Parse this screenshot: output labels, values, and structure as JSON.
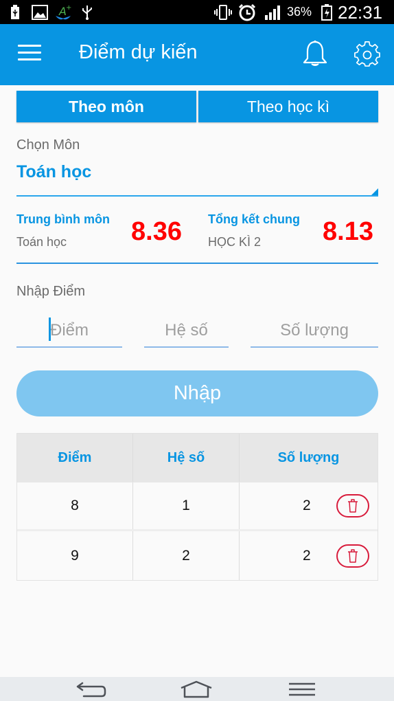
{
  "status_bar": {
    "left_icons": [
      "usb-battery-icon",
      "gallery-icon",
      "app-aplus-icon",
      "usb-icon"
    ],
    "right_icons": [
      "vibrate-icon",
      "alarm-icon",
      "signal-icon",
      "charging-battery-icon"
    ],
    "battery_percent": "36%",
    "time": "22:31"
  },
  "app_bar": {
    "title": "Điểm dự kiến",
    "menu_icon": "hamburger-menu-icon",
    "notification_icon": "bell-icon",
    "settings_icon": "gear-icon"
  },
  "tabs": [
    {
      "label": "Theo môn",
      "active": true
    },
    {
      "label": "Theo học kì",
      "active": false
    }
  ],
  "subject": {
    "label": "Chọn Môn",
    "selected": "Toán học"
  },
  "stats": {
    "subject_avg": {
      "label": "Trung bình môn",
      "sub": "Toán học",
      "value": "8.36"
    },
    "overall": {
      "label": "Tổng kết chung",
      "sub": "HỌC KÌ 2",
      "value": "8.13"
    }
  },
  "entry": {
    "label": "Nhập Điểm",
    "score_placeholder": "Điểm",
    "coef_placeholder": "Hệ số",
    "qty_placeholder": "Số lượng",
    "submit_label": "Nhập"
  },
  "table": {
    "headers": [
      "Điểm",
      "Hệ số",
      "Số lượng"
    ],
    "rows": [
      {
        "score": "8",
        "coef": "1",
        "qty": "2"
      },
      {
        "score": "9",
        "coef": "2",
        "qty": "2"
      }
    ],
    "delete_icon": "trash-icon"
  },
  "nav_bar": {
    "buttons": [
      "back-icon",
      "home-icon",
      "menu-icon"
    ]
  },
  "colors": {
    "primary": "#0895e2",
    "accent_value": "#ff0000",
    "delete": "#d81b3b",
    "button_disabled": "#7fc6f0"
  }
}
